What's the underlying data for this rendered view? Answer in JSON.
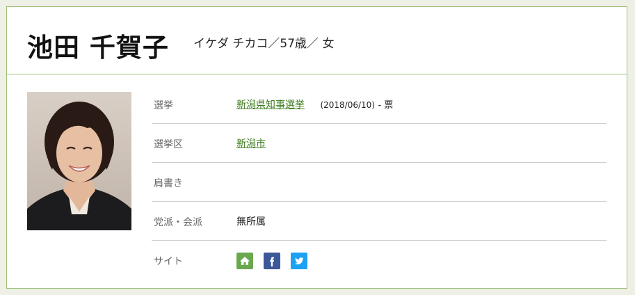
{
  "profile": {
    "name": "池田 千賀子",
    "kana_age_gender": "イケダ チカコ／57歳／ 女"
  },
  "rows": [
    {
      "label": "選挙",
      "link": "新潟県知事選挙",
      "date": "(2018/06/10)",
      "votes": "- 票"
    },
    {
      "label": "選挙区",
      "link": "新潟市"
    },
    {
      "label": "肩書き",
      "value": ""
    },
    {
      "label": "党派・会派",
      "value": "無所属"
    },
    {
      "label": "サイト",
      "icons": [
        "home-icon",
        "facebook-icon",
        "twitter-icon"
      ]
    }
  ],
  "colors": {
    "border": "#9cc27a",
    "link": "#3f7d1e",
    "home": "#6aa84f",
    "facebook": "#3b5998",
    "twitter": "#1da1f2"
  }
}
